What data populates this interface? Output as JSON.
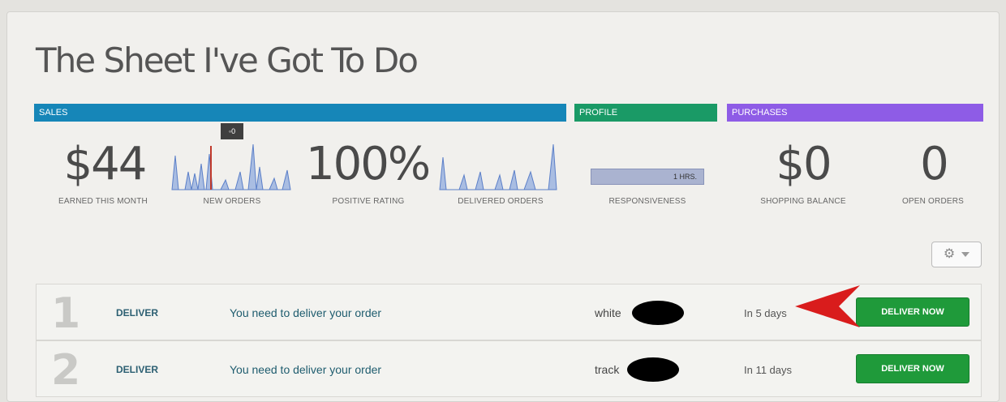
{
  "page": {
    "title": "The Sheet I've Got To Do"
  },
  "sections": {
    "sales": "SALES",
    "profile": "PROFILE",
    "purchases": "PURCHASES"
  },
  "stats": {
    "earned_value": "$44",
    "earned_label": "EARNED THIS MONTH",
    "new_orders_label": "NEW ORDERS",
    "new_orders_tooltip": "0",
    "rating_value": "100%",
    "rating_label": "POSITIVE RATING",
    "delivered_label": "DELIVERED ORDERS",
    "responsiveness_value": "1 HRS.",
    "responsiveness_label": "RESPONSIVENESS",
    "balance_value": "$0",
    "balance_label": "SHOPPING BALANCE",
    "open_orders_value": "0",
    "open_orders_label": "OPEN ORDERS"
  },
  "colors": {
    "sales": "#1686b8",
    "profile": "#1a9a66",
    "purchases": "#8e5ce6",
    "deliver_button": "#1f9a3a",
    "arrow": "#d91c1c"
  },
  "toolbar": {
    "icon": "gear-icon"
  },
  "orders": [
    {
      "number": "1",
      "type": "DELIVER",
      "message": "You need to deliver your order",
      "user": "white",
      "due": "In 5 days",
      "action": "DELIVER NOW"
    },
    {
      "number": "2",
      "type": "DELIVER",
      "message": "You need to deliver your order",
      "user": "track",
      "due": "In 11 days",
      "action": "DELIVER NOW"
    }
  ]
}
